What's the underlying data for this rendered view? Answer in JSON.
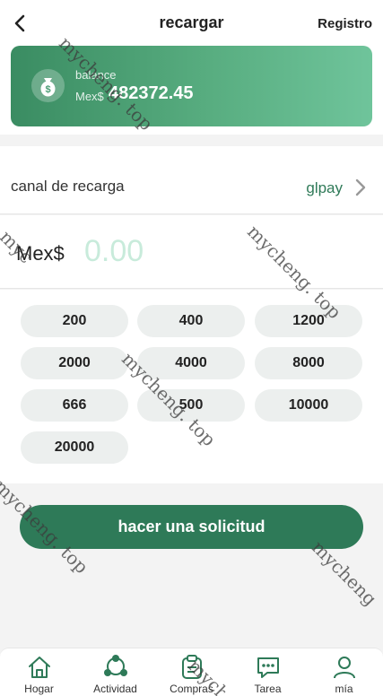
{
  "header": {
    "title": "recargar",
    "right_link": "Registro"
  },
  "balance": {
    "label": "balance",
    "currency": "Mex$",
    "value": "482372.45"
  },
  "channel": {
    "label": "canal de recarga",
    "value": "glpay"
  },
  "amount": {
    "currency": "Mex$",
    "placeholder": "0.00"
  },
  "presets": [
    "200",
    "400",
    "1200",
    "2000",
    "4000",
    "8000",
    "666",
    "500",
    "10000",
    "20000"
  ],
  "submit_label": "hacer una solicitud",
  "nav": [
    {
      "label": "Hogar",
      "icon": "home-icon"
    },
    {
      "label": "Actividad",
      "icon": "activity-icon"
    },
    {
      "label": "Compras",
      "icon": "clipboard-icon"
    },
    {
      "label": "Tarea",
      "icon": "chat-icon"
    },
    {
      "label": "mía",
      "icon": "user-icon"
    }
  ],
  "watermark": "mycheng. top",
  "colors": {
    "primary": "#2e7a58",
    "accent_text": "#2f7a58",
    "amount_placeholder": "#c8ebdb"
  }
}
